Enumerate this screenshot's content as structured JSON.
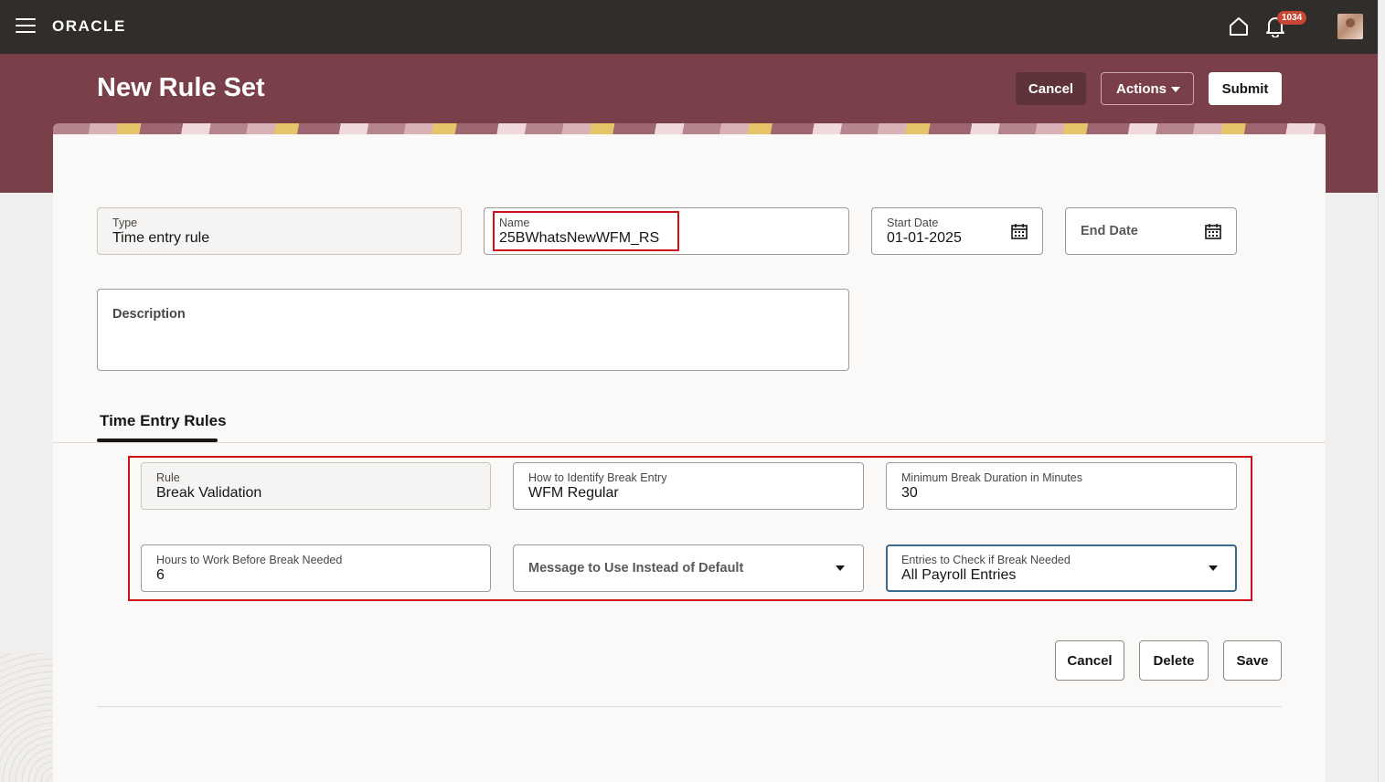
{
  "app": {
    "logo": "ORACLE",
    "notification_count": "1034"
  },
  "header": {
    "title": "New Rule Set",
    "cancel_label": "Cancel",
    "actions_label": "Actions",
    "submit_label": "Submit"
  },
  "form": {
    "type": {
      "label": "Type",
      "value": "Time entry rule"
    },
    "name": {
      "label": "Name",
      "value": "25BWhatsNewWFM_RS"
    },
    "start_date": {
      "label": "Start Date",
      "value": "01-01-2025"
    },
    "end_date": {
      "label": "End Date",
      "value": ""
    },
    "description": {
      "label": "Description",
      "value": ""
    }
  },
  "tabs": [
    {
      "label": "Time Entry Rules",
      "selected": true
    }
  ],
  "rule": {
    "rule": {
      "label": "Rule",
      "value": "Break Validation"
    },
    "identify": {
      "label": "How to Identify Break Entry",
      "value": "WFM Regular"
    },
    "min_break": {
      "label": "Minimum Break Duration in Minutes",
      "value": "30"
    },
    "hours": {
      "label": "Hours to Work Before Break Needed",
      "value": "6"
    },
    "message": {
      "label": "Message to Use Instead of Default",
      "value": ""
    },
    "entries": {
      "label": "Entries to Check if Break Needed",
      "value": "All Payroll Entries"
    }
  },
  "footer": {
    "cancel_label": "Cancel",
    "delete_label": "Delete",
    "save_label": "Save"
  },
  "colors": {
    "banner": "#7a404a",
    "topbar": "#312d2a",
    "highlight": "#d0101a",
    "focus": "#3a6b8c"
  },
  "icons": [
    "menu-icon",
    "home-icon",
    "bell-icon",
    "calendar-icon",
    "chevron-down-icon"
  ]
}
